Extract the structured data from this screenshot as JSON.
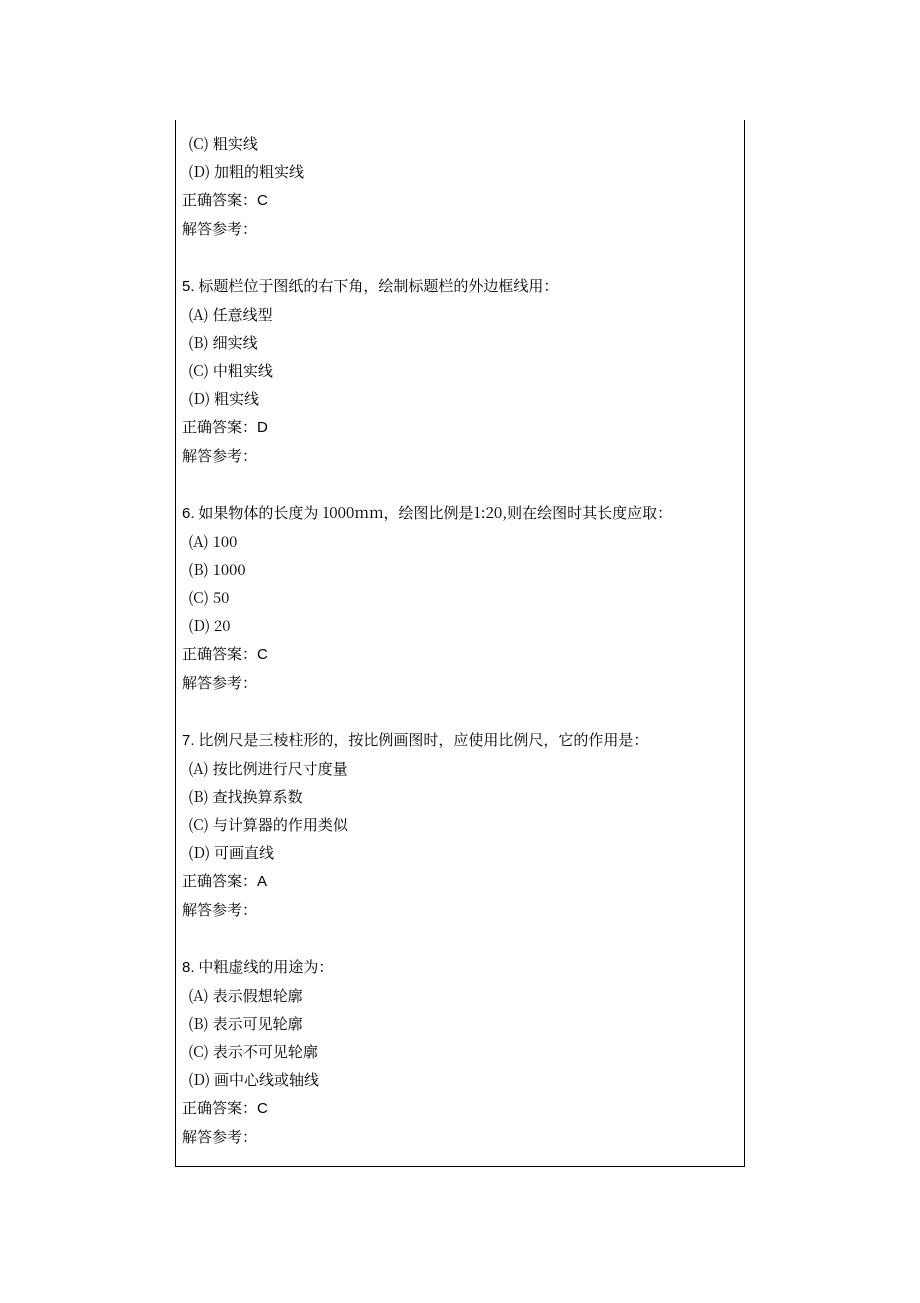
{
  "labels": {
    "correctAnswer": "正确答案：",
    "explanation": "解答参考："
  },
  "partialQuestion4": {
    "optC": "(C)  粗实线",
    "optD": "(D)  加粗的粗实线",
    "answer": "C"
  },
  "q5": {
    "num": "5.",
    "stem": "标题栏位于图纸的右下角，绘制标题栏的外边框线用：",
    "optA": "(A)  任意线型",
    "optB": "(B)  细实线",
    "optC": "(C)  中粗实线",
    "optD": "(D)  粗实线",
    "answer": "D"
  },
  "q6": {
    "num": "6.",
    "stem": "如果物体的长度为 1000mm，绘图比例是1:20,则在绘图时其长度应取：",
    "optA": "(A)  100",
    "optB": "(B)  1000",
    "optC": "(C)  50",
    "optD": "(D)  20",
    "answer": "C"
  },
  "q7": {
    "num": "7.",
    "stem": "比例尺是三棱柱形的，按比例画图时，应使用比例尺，它的作用是：",
    "optA": "(A)  按比例进行尺寸度量",
    "optB": "(B)  查找换算系数",
    "optC": "(C)  与计算器的作用类似",
    "optD": "(D)  可画直线",
    "answer": "A"
  },
  "q8": {
    "num": "8.",
    "stem": "中粗虚线的用途为：",
    "optA": "(A)  表示假想轮廓",
    "optB": "(B)  表示可见轮廓",
    "optC": "(C)  表示不可见轮廓",
    "optD": "(D)  画中心线或轴线",
    "answer": "C"
  }
}
